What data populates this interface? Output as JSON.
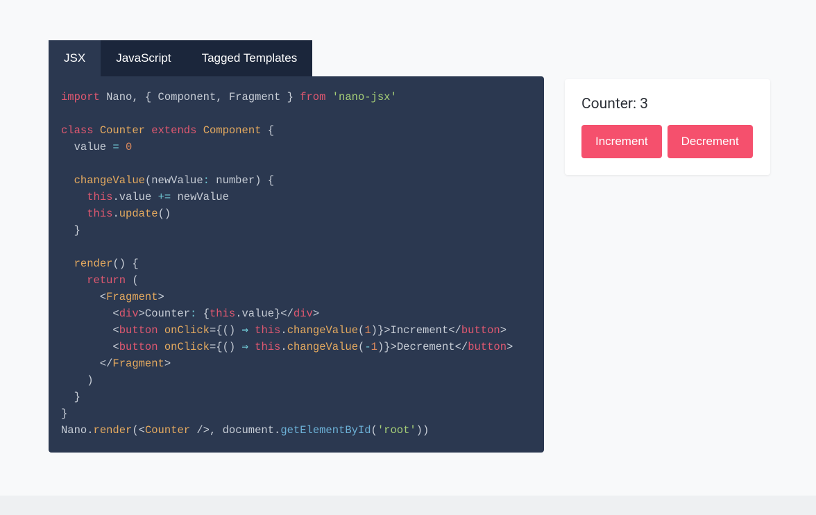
{
  "tabs": {
    "items": [
      {
        "label": "JSX",
        "active": true
      },
      {
        "label": "JavaScript",
        "active": false
      },
      {
        "label": "Tagged Templates",
        "active": false
      }
    ]
  },
  "code": {
    "language": "jsx",
    "lines": [
      [
        [
          "kw",
          "import"
        ],
        [
          "id",
          " Nano"
        ],
        [
          "pun",
          ", { "
        ],
        [
          "id",
          "Component"
        ],
        [
          "pun",
          ", "
        ],
        [
          "id",
          "Fragment"
        ],
        [
          "pun",
          " } "
        ],
        [
          "kw",
          "from"
        ],
        [
          "pun",
          " "
        ],
        [
          "str",
          "'nano-jsx'"
        ]
      ],
      [],
      [
        [
          "kw",
          "class"
        ],
        [
          "pun",
          " "
        ],
        [
          "cls",
          "Counter"
        ],
        [
          "pun",
          " "
        ],
        [
          "kw",
          "extends"
        ],
        [
          "pun",
          " "
        ],
        [
          "cls",
          "Component"
        ],
        [
          "pun",
          " {"
        ]
      ],
      [
        [
          "pun",
          "  value "
        ],
        [
          "op",
          "="
        ],
        [
          "pun",
          " "
        ],
        [
          "num",
          "0"
        ]
      ],
      [],
      [
        [
          "pun",
          "  "
        ],
        [
          "fn",
          "changeValue"
        ],
        [
          "pun",
          "(newValue"
        ],
        [
          "op",
          ":"
        ],
        [
          "pun",
          " number"
        ],
        [
          "pun",
          ")"
        ],
        [
          "pun",
          " {"
        ]
      ],
      [
        [
          "pun",
          "    "
        ],
        [
          "kw",
          "this"
        ],
        [
          "pun",
          ".value "
        ],
        [
          "op",
          "+="
        ],
        [
          "pun",
          " newValue"
        ]
      ],
      [
        [
          "pun",
          "    "
        ],
        [
          "kw",
          "this"
        ],
        [
          "pun",
          "."
        ],
        [
          "fn",
          "update"
        ],
        [
          "pun",
          "()"
        ]
      ],
      [
        [
          "pun",
          "  }"
        ]
      ],
      [],
      [
        [
          "pun",
          "  "
        ],
        [
          "fn",
          "render"
        ],
        [
          "pun",
          "() {"
        ]
      ],
      [
        [
          "pun",
          "    "
        ],
        [
          "kw",
          "return"
        ],
        [
          "pun",
          " ("
        ]
      ],
      [
        [
          "pun",
          "      <"
        ],
        [
          "cls",
          "Fragment"
        ],
        [
          "pun",
          ">"
        ]
      ],
      [
        [
          "pun",
          "        <"
        ],
        [
          "tag",
          "div"
        ],
        [
          "pun",
          ">Counter"
        ],
        [
          "op",
          ":"
        ],
        [
          "pun",
          " {"
        ],
        [
          "kw",
          "this"
        ],
        [
          "pun",
          ".value}</"
        ],
        [
          "tag",
          "div"
        ],
        [
          "pun",
          ">"
        ]
      ],
      [
        [
          "pun",
          "        <"
        ],
        [
          "tag",
          "button"
        ],
        [
          "pun",
          " "
        ],
        [
          "attr",
          "onClick"
        ],
        [
          "pun",
          "={"
        ],
        [
          "pun",
          "()"
        ],
        [
          "pun",
          " "
        ],
        [
          "arrow",
          "⇒"
        ],
        [
          "pun",
          " "
        ],
        [
          "kw",
          "this"
        ],
        [
          "pun",
          "."
        ],
        [
          "fn",
          "changeValue"
        ],
        [
          "pun",
          "("
        ],
        [
          "num",
          "1"
        ],
        [
          "pun",
          ")}>Increment</"
        ],
        [
          "tag",
          "button"
        ],
        [
          "pun",
          ">"
        ]
      ],
      [
        [
          "pun",
          "        <"
        ],
        [
          "tag",
          "button"
        ],
        [
          "pun",
          " "
        ],
        [
          "attr",
          "onClick"
        ],
        [
          "pun",
          "={"
        ],
        [
          "pun",
          "()"
        ],
        [
          "pun",
          " "
        ],
        [
          "arrow",
          "⇒"
        ],
        [
          "pun",
          " "
        ],
        [
          "kw",
          "this"
        ],
        [
          "pun",
          "."
        ],
        [
          "fn",
          "changeValue"
        ],
        [
          "pun",
          "("
        ],
        [
          "op",
          "-"
        ],
        [
          "num",
          "1"
        ],
        [
          "pun",
          ")}>Decrement</"
        ],
        [
          "tag",
          "button"
        ],
        [
          "pun",
          ">"
        ]
      ],
      [
        [
          "pun",
          "      </"
        ],
        [
          "cls",
          "Fragment"
        ],
        [
          "pun",
          ">"
        ]
      ],
      [
        [
          "pun",
          "    )"
        ]
      ],
      [
        [
          "pun",
          "  }"
        ]
      ],
      [
        [
          "pun",
          "}"
        ]
      ],
      [
        [
          "id",
          "Nano"
        ],
        [
          "pun",
          "."
        ],
        [
          "fn",
          "render"
        ],
        [
          "pun",
          "(<"
        ],
        [
          "cls",
          "Counter"
        ],
        [
          "pun",
          " />, document."
        ],
        [
          "meth",
          "getElementById"
        ],
        [
          "pun",
          "("
        ],
        [
          "str",
          "'root'"
        ],
        [
          "pun",
          "))"
        ]
      ]
    ]
  },
  "preview": {
    "counter_label": "Counter: ",
    "counter_value": "3",
    "increment_label": "Increment",
    "decrement_label": "Decrement"
  }
}
